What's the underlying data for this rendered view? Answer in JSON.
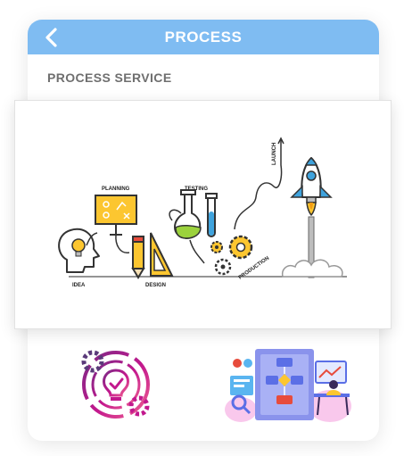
{
  "header": {
    "title": "PROCESS",
    "back_icon": "chevron-left-icon"
  },
  "section": {
    "title": "PROCESS SERVICE"
  },
  "illustration": {
    "labels": {
      "idea": "IDEA",
      "planning": "PLANNING",
      "design": "DESIGN",
      "testing": "TESTING",
      "production": "PRODUCTION",
      "launch": "LAUNCH"
    }
  },
  "thumbnails": [
    {
      "icon": "lightbulb-gears-icon"
    },
    {
      "icon": "flowchart-workspace-icon"
    }
  ],
  "colors": {
    "header": "#7fbcf2",
    "accent_yellow": "#fcc630",
    "accent_blue": "#3fa3dd",
    "accent_magenta": "#c2188d"
  }
}
